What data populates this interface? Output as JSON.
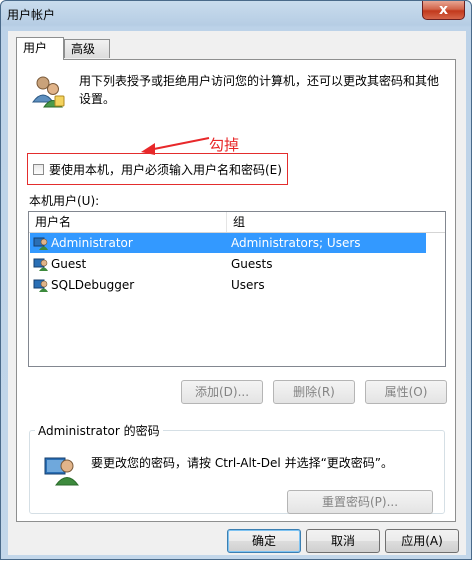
{
  "window": {
    "title": "用户帐户",
    "close_label": "x"
  },
  "tabs": [
    {
      "label": "用户"
    },
    {
      "label": "高级"
    }
  ],
  "intro": {
    "text": "用下列表授予或拒绝用户访问您的计算机，还可以更改其密码和其他设置。"
  },
  "annotation": {
    "text": "勾掉",
    "color": "#e8282a"
  },
  "checkbox": {
    "label": "要使用本机，用户必须输入用户名和密码(E)",
    "checked": false
  },
  "local_users": {
    "label": "本机用户(U):",
    "columns": [
      "用户名",
      "组"
    ],
    "rows": [
      {
        "name": "Administrator",
        "group": "Administrators; Users",
        "selected": true
      },
      {
        "name": "Guest",
        "group": "Guests",
        "selected": false
      },
      {
        "name": "SQLDebugger",
        "group": "Users",
        "selected": false
      }
    ]
  },
  "list_buttons": {
    "add": "添加(D)...",
    "remove": "删除(R)",
    "properties": "属性(O)"
  },
  "password_group": {
    "title": "Administrator 的密码",
    "text": "要更改您的密码，请按 Ctrl-Alt-Del 并选择“更改密码”。",
    "reset_button": "重置密码(P)..."
  },
  "dialog_buttons": {
    "ok": "确定",
    "cancel": "取消",
    "apply": "应用(A)"
  },
  "colors": {
    "selection": "#3399ff",
    "annotation_box": "#e32d2d"
  }
}
